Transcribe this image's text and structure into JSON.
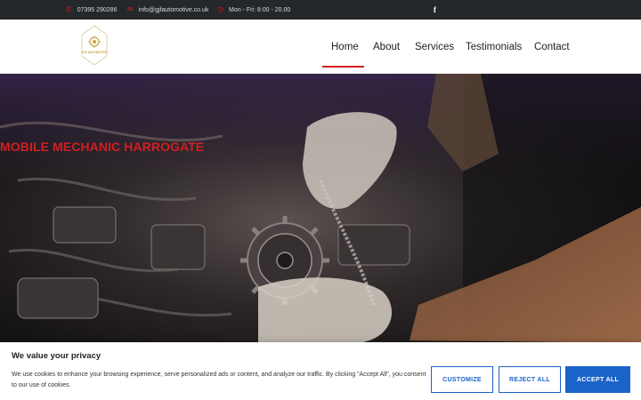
{
  "topbar": {
    "phone": "07395 290286",
    "email": "info@gjfautomotive.co.uk",
    "hours": "Mon - Fri: 8:00 - 20.00",
    "social_icon": "f"
  },
  "header": {
    "logo_text": "GJF AUTOMOTIVE",
    "nav": [
      "Home",
      "About",
      "Services",
      "Testimonials",
      "Contact"
    ],
    "active_nav": "Home"
  },
  "hero": {
    "title": "MOBILE MECHANIC HARROGATE"
  },
  "cookie_banner": {
    "title": "We value your privacy",
    "text": "We use cookies to enhance your browsing experience, serve personalized ads or content, and analyze our traffic. By clicking \"Accept All\", you consent to our use of cookies.",
    "customize": "CUSTOMIZE",
    "reject": "REJECT ALL",
    "accept": "ACCEPT ALL"
  },
  "colors": {
    "accent": "#d21f1f",
    "topbar_bg": "#25282a",
    "button_blue": "#1c63c9",
    "logo_gold": "#c9a24a"
  }
}
